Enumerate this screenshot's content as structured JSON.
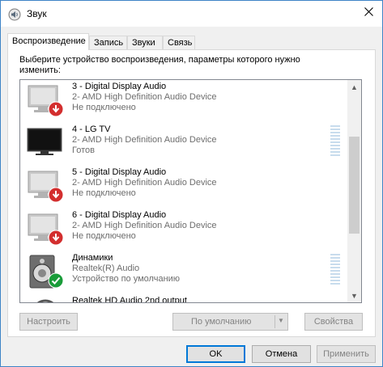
{
  "window": {
    "title": "Звук",
    "title_icon": "speaker-settings-icon",
    "close_icon": "close-icon"
  },
  "tabs": [
    {
      "label": "Воспроизведение",
      "active": true
    },
    {
      "label": "Запись",
      "active": false
    },
    {
      "label": "Звуки",
      "active": false
    },
    {
      "label": "Связь",
      "active": false
    }
  ],
  "instruction": "Выберите устройство воспроизведения, параметры которого нужно изменить:",
  "devices": [
    {
      "name": "3 - Digital Display Audio",
      "description": "2- AMD High Definition Audio Device",
      "status": "Не подключено",
      "icon": "monitor-disconnected-icon",
      "badge": "red-down-arrow-icon"
    },
    {
      "name": "4 - LG TV",
      "description": "2- AMD High Definition Audio Device",
      "status": "Готов",
      "icon": "tv-icon",
      "badge": ""
    },
    {
      "name": "5 - Digital Display Audio",
      "description": "2- AMD High Definition Audio Device",
      "status": "Не подключено",
      "icon": "monitor-disconnected-icon",
      "badge": "red-down-arrow-icon"
    },
    {
      "name": "6 - Digital Display Audio",
      "description": "2- AMD High Definition Audio Device",
      "status": "Не подключено",
      "icon": "monitor-disconnected-icon",
      "badge": "red-down-arrow-icon"
    },
    {
      "name": "Динамики",
      "description": "Realtek(R) Audio",
      "status": "Устройство по умолчанию",
      "icon": "speaker-icon",
      "badge": "green-check-icon"
    },
    {
      "name": "Realtek HD Audio 2nd output",
      "description": "",
      "status": "",
      "icon": "headphones-icon",
      "badge": ""
    }
  ],
  "buttons": {
    "configure": "Настроить",
    "default": "По умолчанию",
    "properties": "Свойства",
    "ok": "OK",
    "cancel": "Отмена",
    "apply": "Применить"
  },
  "colors": {
    "accent": "#0078d7",
    "disconnected_badge": "#d32f2f",
    "default_badge": "#1a9c3a",
    "level_meter": "#c8dced"
  }
}
